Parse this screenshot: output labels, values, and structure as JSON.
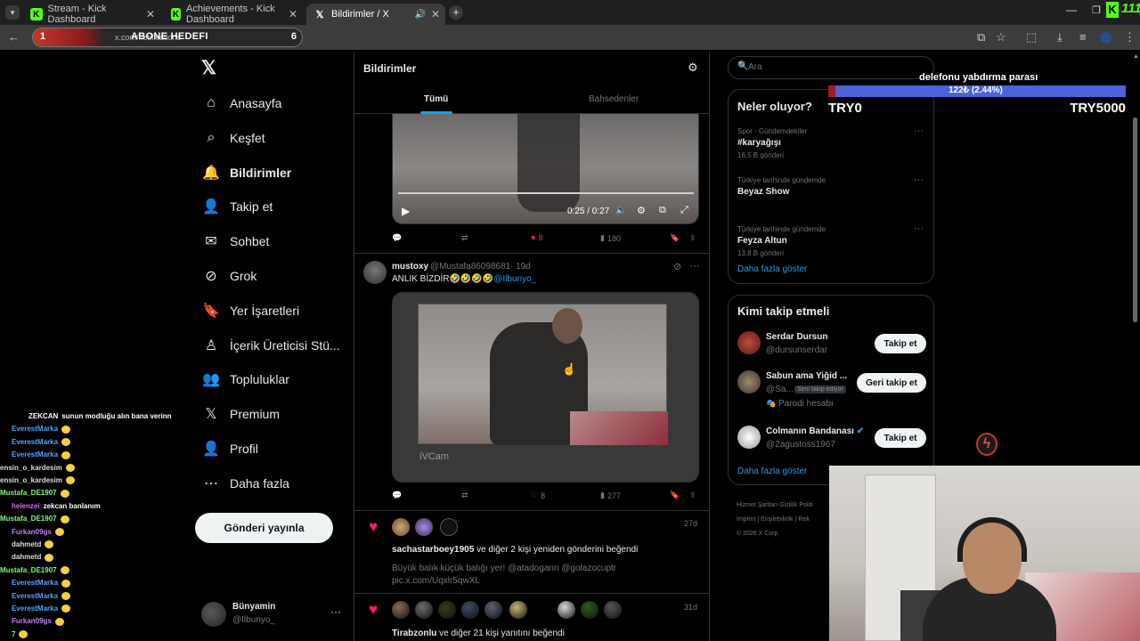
{
  "browser": {
    "tabs": [
      {
        "label": "Stream - Kick Dashboard",
        "active": false
      },
      {
        "label": "Achievements - Kick Dashboard",
        "active": false
      },
      {
        "label": "Bildirimler / X",
        "active": true
      }
    ],
    "url": "x.com/notifications"
  },
  "overlay": {
    "abone_counter_left": "1",
    "abone_title": "ABONE HEDEFI",
    "abone_counter_right": "6",
    "donation_title": "delefonu yabdırma parası",
    "donation_progress_text": "122₺ (2.44%)",
    "donation_progress": 0.0244,
    "donation_min": "TRY0",
    "donation_max": "TRY5000",
    "kick_badge": "111"
  },
  "sidebar": {
    "items": [
      {
        "label": "Anasayfa",
        "icon": "home-icon"
      },
      {
        "label": "Keşfet",
        "icon": "search-icon"
      },
      {
        "label": "Bildirimler",
        "icon": "bell-icon"
      },
      {
        "label": "Takip et",
        "icon": "add-user-icon"
      },
      {
        "label": "Sohbet",
        "icon": "mail-icon"
      },
      {
        "label": "Grok",
        "icon": "grok-icon"
      },
      {
        "label": "Yer İşaretleri",
        "icon": "bookmark-icon"
      },
      {
        "label": "İçerik Üreticisi Stü...",
        "icon": "creator-studio-icon"
      },
      {
        "label": "Topluluklar",
        "icon": "communities-icon"
      },
      {
        "label": "Premium",
        "icon": "x-premium-icon"
      },
      {
        "label": "Profil",
        "icon": "profile-icon"
      },
      {
        "label": "Daha fazla",
        "icon": "more-icon"
      }
    ],
    "post_button": "Gönderi yayınla",
    "account": {
      "name": "Bünyamin",
      "handle": "@Ilbunyo_"
    }
  },
  "main": {
    "title": "Bildirimler",
    "tabs": [
      "Tümü",
      "Bahsedenler"
    ],
    "video1": {
      "time": "0:25 / 0:27",
      "likes": "8",
      "views": "180"
    },
    "post": {
      "author": "mustoxy",
      "handle": "@Mustafa86098681",
      "age": "· 19d",
      "text": "ANLIK BİZDİR🤣🤣🤣🤣",
      "mention": "@Ilbunyo_",
      "watermark": "iVCam",
      "likes": "8",
      "views": "277"
    },
    "notif1": {
      "age": "27d",
      "user": "sachastarboey1905",
      "action": "ve diğer 2 kişi yeniden gönderini beğendi",
      "quote": "Büyük balık küçük balığı yer! @atadogann  @golazocuptr",
      "link": "pic.x.com/Uqxlr5qwXL"
    },
    "notif2": {
      "age": "31d",
      "user": "Tirabzonlu",
      "action": "ve diğer 21 kişi yanıtını beğendi"
    }
  },
  "right": {
    "search_placeholder": "Ara",
    "trends_title": "Neler oluyor?",
    "trends": [
      {
        "meta": "Spor · Gündemdekiler",
        "name": "#karyağışı",
        "count": "16,5 B gönderi"
      },
      {
        "meta": "Türkiye tarihinde gündemde",
        "name": "Beyaz Show",
        "count": ""
      },
      {
        "meta": "Türkiye tarihinde gündemde",
        "name": "Feyza Altun",
        "count": "13,8 B gönderi"
      }
    ],
    "trends_more": "Daha fazla göster",
    "who_title": "Kimi takip etmeli",
    "who": [
      {
        "name": "Serdar Dursun",
        "handle": "@dursunserdar",
        "button": "Takip et",
        "badge": "",
        "note": ""
      },
      {
        "name": "Sabun ama Yiğid ...",
        "handle": "@Sa...",
        "button": "Geri takip et",
        "badge": "Seni takip ediyor",
        "note": "Parodi hesabı"
      },
      {
        "name": "Colmanın Bandanası",
        "handle": "@2agustoss1967",
        "button": "Takip et",
        "badge": "",
        "note": ""
      }
    ],
    "who_more": "Daha fazla göster",
    "footer": [
      "Hizmet Şartları",
      "Gizlilik Politi",
      "Imprint",
      "Erişilebilirlik",
      "Rek",
      "© 2026 X Corp."
    ]
  },
  "chat": [
    {
      "user": "ZEKCAN",
      "msg": "sunun modluğu alın bana verinn",
      "color": "#ffffff"
    },
    {
      "user": "EverestMarka",
      "msg": "",
      "color": "#4fa3ff"
    },
    {
      "user": "EverestMarka",
      "msg": "",
      "color": "#4fa3ff"
    },
    {
      "user": "EverestMarka",
      "msg": "",
      "color": "#4fa3ff"
    },
    {
      "user": "ensin_o_kardesim",
      "msg": "",
      "color": "#dddddd"
    },
    {
      "user": "ensin_o_kardesim",
      "msg": "",
      "color": "#dddddd"
    },
    {
      "user": "Mustafa_DE1907",
      "msg": "",
      "color": "#7cfc7c"
    },
    {
      "user": "helenzei",
      "msg": "zekcan banlanım",
      "color": "#e066ff"
    },
    {
      "user": "Mustafa_DE1907",
      "msg": "",
      "color": "#7cfc7c"
    },
    {
      "user": "Furkan09gs",
      "msg": "",
      "color": "#c77dff"
    },
    {
      "user": "dahmetd",
      "msg": "",
      "color": "#dddddd"
    },
    {
      "user": "dahmetd",
      "msg": "",
      "color": "#dddddd"
    },
    {
      "user": "Mustafa_DE1907",
      "msg": "",
      "color": "#7cfc7c"
    },
    {
      "user": "EverestMarka",
      "msg": "",
      "color": "#4fa3ff"
    },
    {
      "user": "EverestMarka",
      "msg": "",
      "color": "#4fa3ff"
    },
    {
      "user": "EverestMarka",
      "msg": "",
      "color": "#4fa3ff"
    },
    {
      "user": "Furkan09gs",
      "msg": "",
      "color": "#c77dff"
    },
    {
      "user": "7",
      "msg": "",
      "color": "#7cfc7c"
    }
  ],
  "colors": {
    "accent": "#1d9bf0",
    "like": "#f91880",
    "kick": "#53fc18",
    "progress": "#4a63d8"
  }
}
